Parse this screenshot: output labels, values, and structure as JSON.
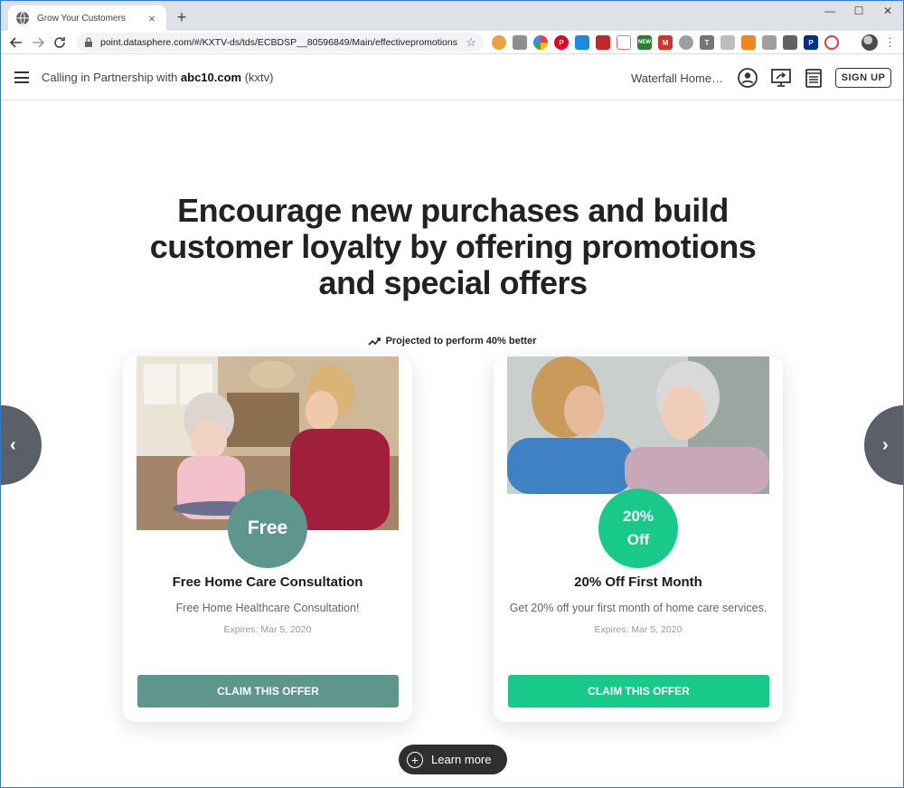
{
  "browser": {
    "tab_title": "Grow Your Customers",
    "tab_close": "×",
    "new_tab": "+",
    "window_controls": {
      "minimize": "—",
      "maximize": "☐",
      "close": "✕"
    },
    "url": "point.datasphere.com/#/KXTV-ds/tds/ECBDSP__80596849/Main/effectivepromotions",
    "extensions": [
      "cookie-icon",
      "camera-icon",
      "color-wheel-icon",
      "pinterest-icon",
      "news-icon",
      "bookmark-icon",
      "calendar-icon",
      "new-badge-icon",
      "gmail-icon",
      "grammar-icon",
      "text-icon",
      "screenshot-icon",
      "metamask-icon",
      "translate-icon",
      "puzzle-icon",
      "paypal-icon",
      "swirl-icon"
    ],
    "new_label": "NEW",
    "kebab": "⋮"
  },
  "header": {
    "partner_prefix": "Calling in Partnership with ",
    "partner_domain": "abc10.com",
    "partner_suffix": " (kxtv)",
    "business_name": "Waterfall HomeCare",
    "signup_label": "SIGN UP"
  },
  "main": {
    "headline": "Encourage new purchases and build customer loyalty by offering promotions and special offers",
    "projection": "Projected to perform 40% better",
    "learn_more": "Learn more"
  },
  "offers": [
    {
      "badge": "Free",
      "title": "Free Home Care Consultation",
      "description": "Free Home Healthcare Consultation!",
      "expires": "Expires: Mar 5, 2020",
      "cta": "CLAIM THIS OFFER",
      "color": "#5e968d"
    },
    {
      "badge_line1": "20%",
      "badge_line2": "Off",
      "title": "20% Off First Month",
      "description": "Get 20% off your first month of home care services.",
      "expires": "Expires: Mar 5, 2020",
      "cta": "CLAIM THIS OFFER",
      "color": "#18c98a"
    }
  ],
  "carousel": {
    "prev": "‹",
    "next": "›"
  }
}
